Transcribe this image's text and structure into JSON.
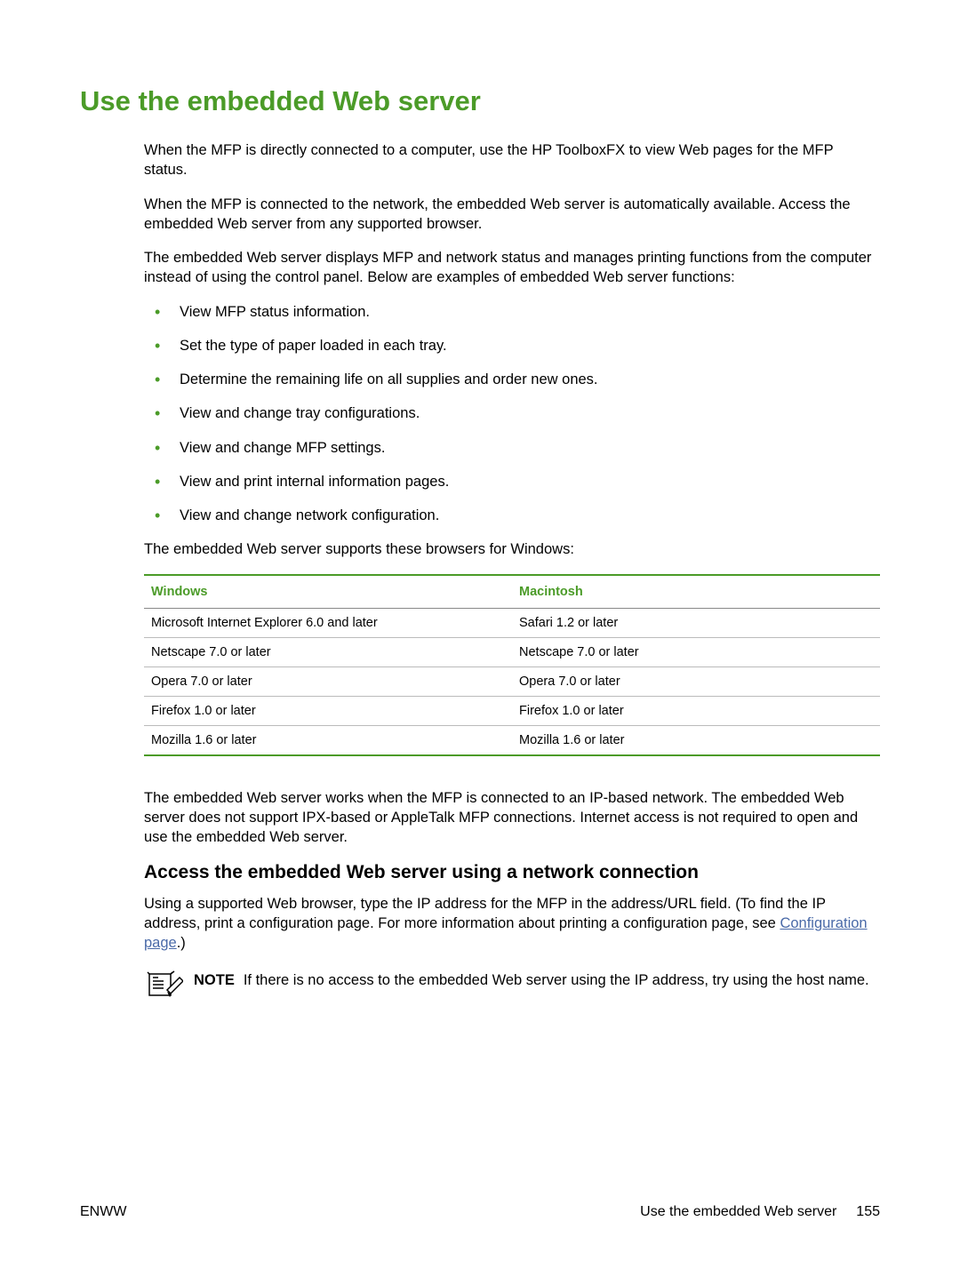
{
  "title": "Use the embedded Web server",
  "intro": {
    "p1": "When the MFP is directly connected to a computer, use the HP ToolboxFX to view Web pages for the MFP status.",
    "p2": "When the MFP is connected to the network, the embedded Web server is automatically available. Access the embedded Web server from any supported browser.",
    "p3": "The embedded Web server displays MFP and network status and manages printing functions from the computer instead of using the control panel. Below are examples of embedded Web server functions:"
  },
  "bullets": [
    "View MFP status information.",
    "Set the type of paper loaded in each tray.",
    "Determine the remaining life on all supplies and order new ones.",
    "View and change tray configurations.",
    "View and change MFP settings.",
    "View and print internal information pages.",
    "View and change network configuration."
  ],
  "browsers_intro": "The embedded Web server supports these browsers for Windows:",
  "table": {
    "headers": {
      "col1": "Windows",
      "col2": "Macintosh"
    },
    "rows": [
      {
        "col1": "Microsoft Internet Explorer 6.0 and later",
        "col2": "Safari 1.2 or later"
      },
      {
        "col1": "Netscape 7.0 or later",
        "col2": "Netscape 7.0 or later"
      },
      {
        "col1": "Opera 7.0 or later",
        "col2": "Opera 7.0 or later"
      },
      {
        "col1": "Firefox 1.0 or later",
        "col2": "Firefox 1.0 or later"
      },
      {
        "col1": "Mozilla 1.6 or later",
        "col2": "Mozilla 1.6 or later"
      }
    ]
  },
  "network_para": "The embedded Web server works when the MFP is connected to an IP-based network. The embedded Web server does not support IPX-based or AppleTalk MFP connections. Internet access is not required to open and use the embedded Web server.",
  "section2": {
    "heading": "Access the embedded Web server using a network connection",
    "para_pre": "Using a supported Web browser, type the IP address for the MFP in the address/URL field. (To find the IP address, print a configuration page. For more information about printing a configuration page, see ",
    "link_text": "Configuration page",
    "para_post": ".)"
  },
  "note": {
    "label": "NOTE",
    "text": "If there is no access to the embedded Web server using the IP address, try using the host name."
  },
  "footer": {
    "left": "ENWW",
    "right_text": "Use the embedded Web server",
    "page_number": "155"
  }
}
